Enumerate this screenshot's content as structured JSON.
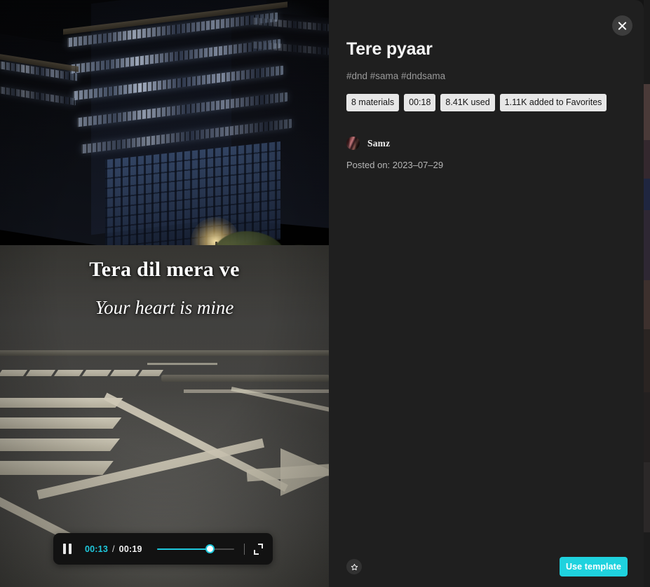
{
  "video": {
    "overlay": {
      "line1": "Tera dil mera ve",
      "line2": "Your heart is mine"
    },
    "controls": {
      "pause_icon": "pause-icon",
      "current_time": "00:13",
      "separator": "/",
      "duration": "00:19",
      "progress_percent": 68,
      "fullscreen_icon": "fullscreen-icon",
      "accent_color": "#1ec8dc"
    }
  },
  "panel": {
    "close_icon": "close-icon",
    "title": "Tere pyaar",
    "tags": "#dnd #sama #dndsama",
    "badges": [
      "8 materials",
      "00:18",
      "8.41K used",
      "1.11K added to Favorites"
    ],
    "author": {
      "avatar_icon": "avatar",
      "name": "Samz"
    },
    "posted": "Posted on: 2023–07–29",
    "footer": {
      "favorite_icon": "star-icon",
      "use_template_label": "Use template",
      "use_template_color": "#1fd2de"
    }
  }
}
